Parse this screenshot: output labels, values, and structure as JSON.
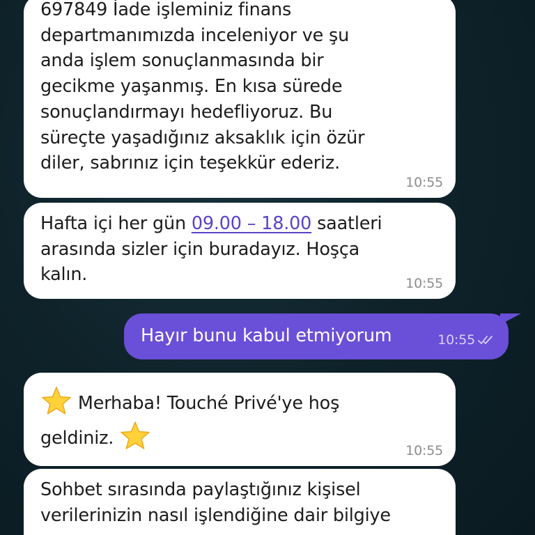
{
  "messages": [
    {
      "direction": "incoming",
      "lines": [
        "697849 İade işleminiz finans",
        "departmanımızda inceleniyor ve şu",
        "anda işlem sonuçlanmasında bir",
        "gecikme yaşanmış. En kısa sürede",
        "sonuçlandırmayı hedefliyoruz. Bu",
        "süreçte yaşadığınız aksaklık için özür",
        "diler, sabrınız için teşekkür ederiz."
      ],
      "time": "10:55"
    },
    {
      "direction": "incoming",
      "line1_before": "Hafta içi her gün ",
      "line1_link": "09.00 – 18.00",
      "line1_after": " saatleri",
      "line2": "arasında sizler için buradayız. Hoşça",
      "line3": "kalın.",
      "time": "10:55"
    },
    {
      "direction": "outgoing",
      "text": "Hayır bunu kabul etmiyorum",
      "time": "10:55",
      "status_icon": "double-check-icon"
    },
    {
      "direction": "incoming",
      "line1": "Merhaba! Touché Privé'ye hoş",
      "line2": "geldiniz.",
      "icon": "star-emoji-icon",
      "time": "10:55"
    },
    {
      "direction": "incoming",
      "lines": [
        "Sohbet sırasında paylaştığınız kişisel",
        "verilerinizin nasıl işlendiğine dair bilgiye"
      ]
    }
  ],
  "colors": {
    "incoming_bubble": "#ffffff",
    "outgoing_bubble": "#6a4fd8",
    "link": "#5b43c9",
    "timestamp": "#8c8c8c"
  }
}
